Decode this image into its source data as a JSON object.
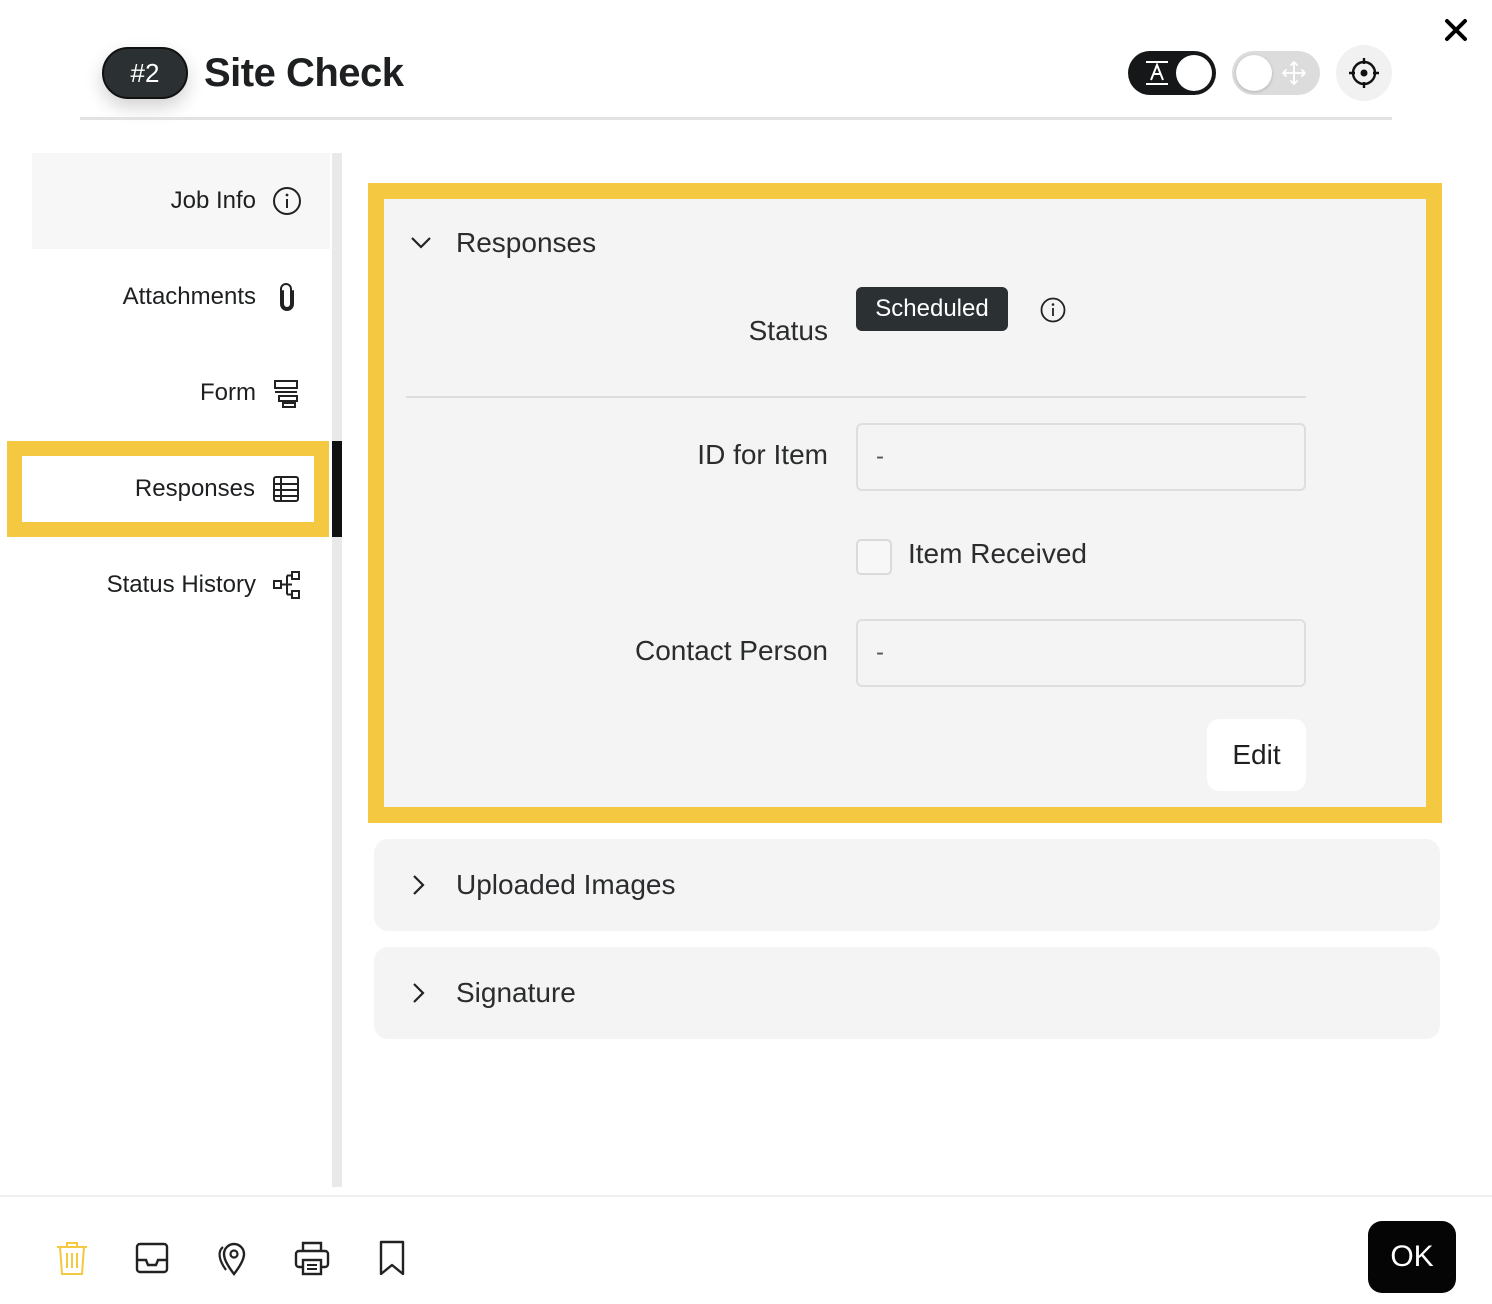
{
  "header": {
    "badge": "#2",
    "title": "Site Check"
  },
  "sidebar": {
    "items": [
      {
        "label": "Job Info",
        "icon": "info-icon"
      },
      {
        "label": "Attachments",
        "icon": "paperclip-icon"
      },
      {
        "label": "Form",
        "icon": "form-icon"
      },
      {
        "label": "Responses",
        "icon": "table-icon",
        "active": true
      },
      {
        "label": "Status History",
        "icon": "flow-icon"
      }
    ]
  },
  "responses_panel": {
    "title": "Responses",
    "status_label": "Status",
    "status_value": "Scheduled",
    "fields": [
      {
        "label": "ID for Item",
        "value": "-"
      },
      {
        "label": "Contact Person",
        "value": "-"
      }
    ],
    "checkbox_label": "Item Received",
    "edit_label": "Edit"
  },
  "accordions": [
    {
      "label": "Uploaded Images"
    },
    {
      "label": "Signature"
    }
  ],
  "footer": {
    "ok_label": "OK",
    "icons": [
      "trash-icon",
      "inbox-icon",
      "map-pin-icon",
      "print-icon",
      "bookmark-icon"
    ]
  },
  "colors": {
    "highlight": "#f5c842",
    "dark": "#2b3033",
    "trash": "#f5c842"
  }
}
